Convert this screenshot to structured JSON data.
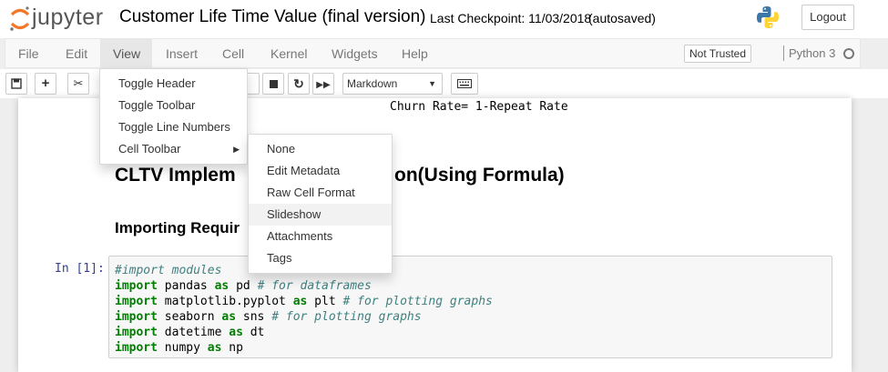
{
  "header": {
    "logo_text": "jupyter",
    "notebook_title": "Customer Life Time Value (final version)",
    "checkpoint": "Last Checkpoint: 11/03/2018",
    "autosave": "(autosaved)",
    "logout_label": "Logout"
  },
  "menubar": {
    "items": [
      "File",
      "Edit",
      "View",
      "Insert",
      "Cell",
      "Kernel",
      "Widgets",
      "Help"
    ],
    "active": "View",
    "trust_label": "Not Trusted",
    "kernel_name": "Python 3"
  },
  "toolbar": {
    "cell_type": "Markdown",
    "icons": [
      "save-icon",
      "add-cell-icon",
      "cut-icon",
      "run-icon",
      "stop-icon",
      "restart-icon",
      "fast-forward-icon",
      "keyboard-icon"
    ]
  },
  "view_menu": {
    "items": [
      "Toggle Header",
      "Toggle Toolbar",
      "Toggle Line Numbers",
      "Cell Toolbar"
    ]
  },
  "cell_toolbar_menu": {
    "items": [
      "None",
      "Edit Metadata",
      "Raw Cell Format",
      "Slideshow",
      "Attachments",
      "Tags"
    ],
    "hovered": "Slideshow"
  },
  "notebook": {
    "churn_text": "Churn Rate= 1-Repeat Rate",
    "heading1_start": "CLTV Implem",
    "heading1_end": "on(Using Formula)",
    "heading2": "Importing Requir",
    "prompt": "In [1]:",
    "code": {
      "comment1": "#import modules",
      "kw_import": "import",
      "kw_as": "as",
      "line2_mod": " pandas ",
      "line2_alias": " pd ",
      "line2_comment": "# for dataframes",
      "line3_mod": " matplotlib.pyplot ",
      "line3_alias": " plt ",
      "line3_comment": "# for plotting graphs",
      "line4_mod": " seaborn ",
      "line4_alias": " sns ",
      "line4_comment": "# for plotting graphs",
      "line5_mod": " datetime ",
      "line5_alias": " dt",
      "line6_mod": " numpy ",
      "line6_alias": " np"
    }
  },
  "colors": {
    "jupyter_orange": "#f37726",
    "prompt_blue": "#303f9f",
    "keyword_green": "#008000",
    "comment_teal": "#408080"
  }
}
